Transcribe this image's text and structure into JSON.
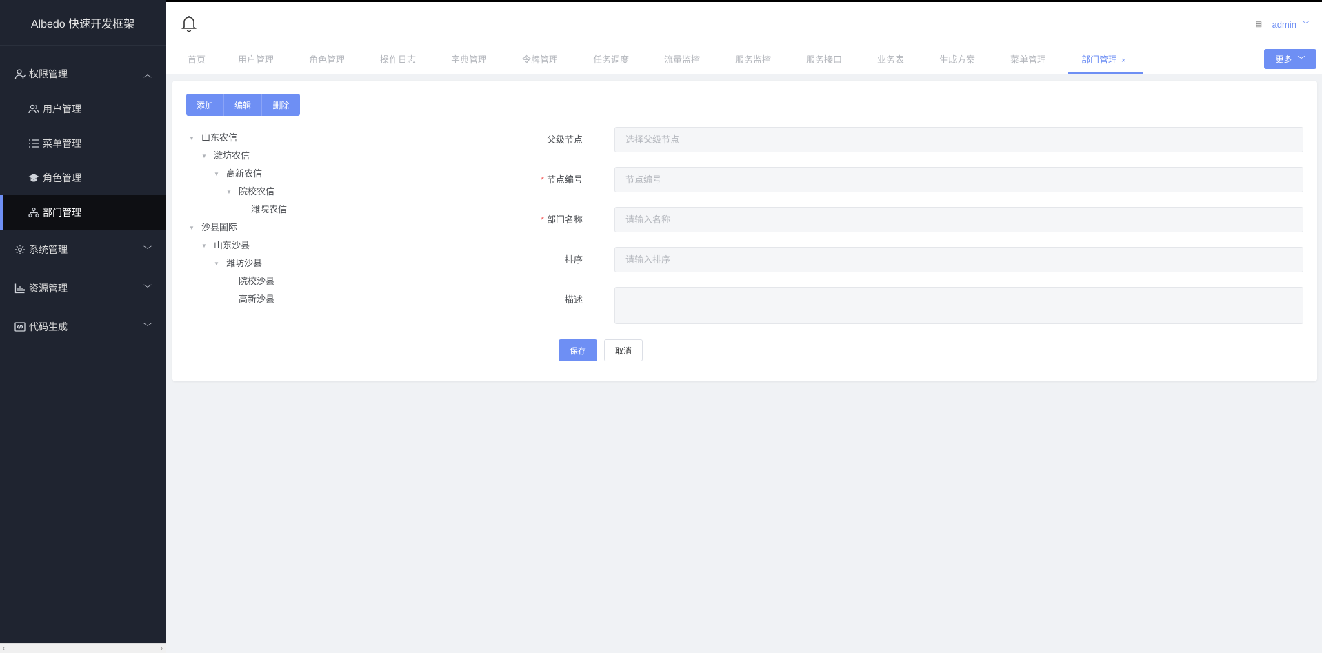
{
  "app": {
    "title": "Albedo 快速开发框架"
  },
  "sidebar": {
    "groups": [
      {
        "label": "权限管理",
        "icon": "user-shield-icon",
        "expanded": true,
        "items": [
          {
            "label": "用户管理",
            "icon": "users-icon"
          },
          {
            "label": "菜单管理",
            "icon": "list-icon"
          },
          {
            "label": "角色管理",
            "icon": "graduation-cap-icon"
          },
          {
            "label": "部门管理",
            "icon": "sitemap-icon",
            "active": true
          }
        ]
      },
      {
        "label": "系统管理",
        "icon": "gear-icon",
        "expanded": false
      },
      {
        "label": "资源管理",
        "icon": "bar-chart-icon",
        "expanded": false
      },
      {
        "label": "代码生成",
        "icon": "code-icon",
        "expanded": false
      }
    ]
  },
  "header": {
    "user": "admin"
  },
  "tabs": {
    "items": [
      "首页",
      "用户管理",
      "角色管理",
      "操作日志",
      "字典管理",
      "令牌管理",
      "任务调度",
      "流量监控",
      "服务监控",
      "服务接口",
      "业务表",
      "生成方案",
      "菜单管理",
      "部门管理"
    ],
    "active": "部门管理",
    "close": "×",
    "more": "更多"
  },
  "toolbar": {
    "add": "添加",
    "edit": "编辑",
    "delete": "删除"
  },
  "tree": [
    {
      "label": "山东农信",
      "level": 0,
      "hasChildren": true
    },
    {
      "label": "潍坊农信",
      "level": 1,
      "hasChildren": true
    },
    {
      "label": "高新农信",
      "level": 2,
      "hasChildren": true
    },
    {
      "label": "院校农信",
      "level": 3,
      "hasChildren": true
    },
    {
      "label": "潍院农信",
      "level": 4,
      "hasChildren": false
    },
    {
      "label": "沙县国际",
      "level": 0,
      "hasChildren": true
    },
    {
      "label": "山东沙县",
      "level": 1,
      "hasChildren": true
    },
    {
      "label": "潍坊沙县",
      "level": 2,
      "hasChildren": true
    },
    {
      "label": "院校沙县",
      "level": 3,
      "hasChildren": false
    },
    {
      "label": "高新沙县",
      "level": 3,
      "hasChildren": false
    }
  ],
  "form": {
    "parent": {
      "label": "父级节点",
      "placeholder": "选择父级节点",
      "required": false
    },
    "code": {
      "label": "节点编号",
      "placeholder": "节点编号",
      "required": true
    },
    "name": {
      "label": "部门名称",
      "placeholder": "请输入名称",
      "required": true
    },
    "sort": {
      "label": "排序",
      "placeholder": "请输入排序",
      "required": false
    },
    "desc": {
      "label": "描述",
      "placeholder": "",
      "required": false
    },
    "required_mark": "*",
    "save": "保存",
    "cancel": "取消"
  },
  "colors": {
    "primary": "#6e8ff4",
    "sidebar_bg": "#1f2430",
    "sidebar_active_bg": "#0e0f13"
  }
}
